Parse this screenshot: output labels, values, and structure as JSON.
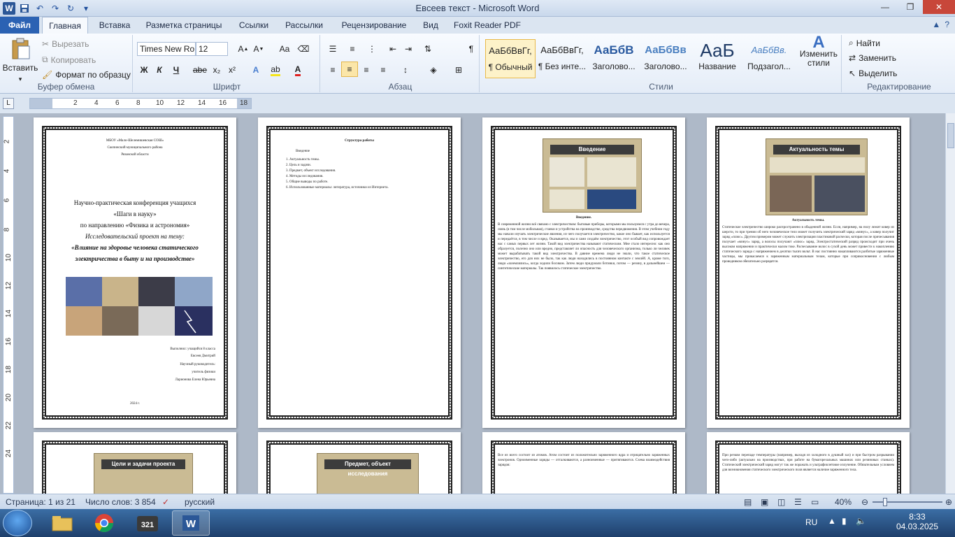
{
  "window": {
    "title": "Евсеев текст  -  Microsoft Word"
  },
  "tabs": [
    {
      "label": "Файл"
    },
    {
      "label": "Главная"
    },
    {
      "label": "Вставка"
    },
    {
      "label": "Разметка страницы"
    },
    {
      "label": "Ссылки"
    },
    {
      "label": "Рассылки"
    },
    {
      "label": "Рецензирование"
    },
    {
      "label": "Вид"
    },
    {
      "label": "Foxit Reader PDF"
    }
  ],
  "clipboard": {
    "paste": "Вставить",
    "cut": "Вырезать",
    "copy": "Копировать",
    "format_painter": "Формат по образцу",
    "label": "Буфер обмена"
  },
  "font": {
    "name": "Times New Ro",
    "size": "12",
    "label": "Шрифт",
    "bold": "Ж",
    "italic": "К",
    "underline": "Ч",
    "strike": "abe",
    "sub": "x₂",
    "sup": "x²",
    "case": "Aa"
  },
  "paragraph": {
    "label": "Абзац",
    "marks": "¶"
  },
  "styles": {
    "label": "Стили",
    "items": [
      {
        "sample": "АаБбВвГг,",
        "name": "¶ Обычный"
      },
      {
        "sample": "АаБбВвГг,",
        "name": "¶ Без инте..."
      },
      {
        "sample": "АаБбВ",
        "name": "Заголово..."
      },
      {
        "sample": "АаБбВв",
        "name": "Заголово..."
      },
      {
        "sample": "АаБ",
        "name": "Название"
      },
      {
        "sample": "АаБбВв.",
        "name": "Подзагол..."
      }
    ],
    "change": "Изменить стили"
  },
  "editing": {
    "label": "Редактирование",
    "find": "Найти",
    "replace": "Заменить",
    "select": "Выделить"
  },
  "ruler": {
    "marks": [
      "2",
      "4",
      "6",
      "8",
      "10",
      "12",
      "14",
      "16",
      "18"
    ],
    "vmarks": [
      "2",
      "4",
      "6",
      "8",
      "10",
      "12",
      "14",
      "16",
      "18",
      "20",
      "22",
      "24"
    ]
  },
  "pages": {
    "p1": {
      "school": "МБОУ «Мало-Шелемишевская СОШ»",
      "district": "Скопинский муниципального района",
      "region": "Рязанской области",
      "conf1": "Научно-практическая конференция учащихся",
      "conf2": "«Шаги в науку»",
      "conf3": "по направлению «Физика и астрономия»",
      "conf4": "Исследовательский проект на тему:",
      "conf5": "«Влияние на здоровье человека статического электричества в быту и на производстве»",
      "auth1": "Выполнил: учащийся 8 класса",
      "auth2": "Евсеев Дмитрий",
      "auth3": "Научный руководитель:",
      "auth4": "учитель физики",
      "auth5": "Ларионова Елена Юрьевна",
      "year": "2024 г."
    },
    "p2": {
      "title": "Структура работы",
      "intro": "Введение",
      "items": [
        "1.  Актуальность темы.",
        "2.  Цель и задачи.",
        "3.  Предмет, объект исследования.",
        "4.  Методы исследования.",
        "5.  Общие выводы по работе.",
        "6.  Использованные материалы: литература, источники из Интернета."
      ]
    },
    "p3": {
      "slide_title": "Введение",
      "heading": "Введение.",
      "text": "В современной жизни всё связано с электричеством: бытовые приборы, которыми мы пользуемся с утра до вечера, связь (в том числе мобильная), станки и устройства на производстве, средства передвижения. В этом учебном году мы начали изучать электрические явления, из чего получается электричество, какое оно бывает, как используется и передаётся, в том числе и вред. Оказывается, мы и сами создаём электричество, этот особый вид сопровождает нас с самых первых лет жизни. Такой вид электричества называют статическим. Мне стало интересно: как оно образуется, полезно оно или вредно, представляет ли опасность для человеческого организма, только ли человек может вырабатывать такой вид электричества. В давние времена люди не знали, что такое статическое электричество, его для них не было, так как люди находились в постоянном контакте с землёй. А, кроме того, люди «заземлялись», когда ходили босиком. Затем люди придумали ботинки, потом — резину, в дальнейшем — синтетические материалы. Так появилось статическое электричество."
    },
    "p4": {
      "slide_title": "Актуальность темы",
      "heading": "Актуальность темы.",
      "text": "Статическое электричество широко распространено в обыденной жизни. Если, например, на полу лежит ковер из шерсти, то при трении об него человеческое тело может получить электрический заряд «минус», а ковер получит заряд «плюс». Другим примером может служить электризация пластиковой расчески, которая после причесывания получает «минус» заряд, а волосы получают «плюс» заряд. Электростатический разряд происходит при очень высоком напряжении и практически малом токе. Расчесывание волос в сухой день может привести к накоплению статического заряда с напряжением в десятки тысяч вольт. В нас постоянно накапливаются разбитые заряженные частицы, мы прикасаемся к заряженным материальным телам, которые при соприкосновении с любым проводником обязательно разрядятся."
    },
    "p5": {
      "slide_title": "Цели и задачи проекта"
    },
    "p6": {
      "slide_title": "Предмет, объект исследования"
    },
    "p7": {
      "text": "Все из всего состоит из атомов. Атом состоит из положительно заряженного ядра и отрицательно заряженных электронов. Одноименные заряды — отталкиваются, а разноименные — притягиваются. Схема взаимодействия зарядов:"
    },
    "p8": {
      "text": "При резком перепаде температуры (например, выходя из холодного в душный зал) и при быстром разрывании чего-либо (актуально на производствах, при работе на бумагорезальных машинах или резиновых станках). Статический электрический заряд могут так же поражать и ультрафиолетовое излучение. Обязательным условием для возникновения статического электрического поля является наличие заряженного тела."
    }
  },
  "status": {
    "page": "Страница: 1 из 21",
    "words": "Число слов: 3 854",
    "lang": "русский",
    "zoom": "40%",
    "zoom_level": 0.4
  },
  "taskbar": {
    "lang": "RU",
    "time": "8:33",
    "date": "04.03.2025"
  }
}
